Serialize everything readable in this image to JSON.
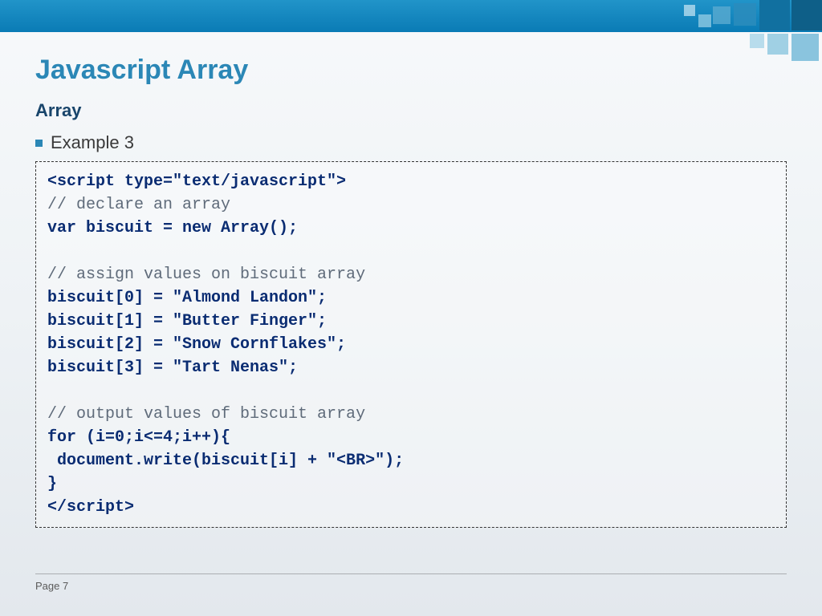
{
  "header": {},
  "slide": {
    "title": "Javascript Array",
    "subtitle": "Array",
    "bullet": "Example 3"
  },
  "code": {
    "l1": "<script type=\"text/javascript\">",
    "l2": "// declare an array",
    "l3": "var biscuit = new Array();",
    "l4": "",
    "l5": "// assign values on biscuit array",
    "l6": "biscuit[0] = \"Almond Landon\";",
    "l7": "biscuit[1] = \"Butter Finger\";",
    "l8": "biscuit[2] = \"Snow Cornflakes\";",
    "l9": "biscuit[3] = \"Tart Nenas\";",
    "l10": "",
    "l11": "// output values of biscuit array",
    "l12": "for (i=0;i<=4;i++){",
    "l13": " document.write(biscuit[i] + \"<BR>\");",
    "l14": "}",
    "l15": "</script>"
  },
  "footer": {
    "page_label": "Page 7"
  }
}
